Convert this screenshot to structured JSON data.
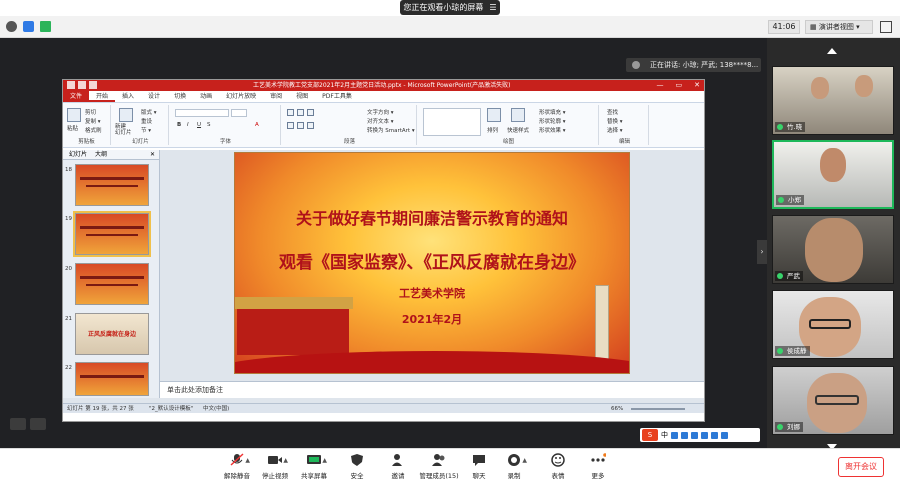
{
  "share_banner": {
    "text": "您正在观看小琼的屏幕"
  },
  "statusbar": {
    "timer": "41:06",
    "view_label": "演讲者视图"
  },
  "speaker": {
    "label": "正在讲话: 小琼; 严武; 138****8..."
  },
  "ppt": {
    "title": "工艺美术学院教工党支部2021年2月主题党日活动.pptx  -  Microsoft PowerPoint(产品激活失败)",
    "menu": [
      "文件",
      "开始",
      "插入",
      "设计",
      "切换",
      "动画",
      "幻灯片放映",
      "审阅",
      "视图",
      "PDF工具集"
    ],
    "ribbon_groups": [
      "剪贴板",
      "幻灯片",
      "字体",
      "段落",
      "绘图",
      "编辑"
    ],
    "ribbon_buttons": {
      "paste": "粘贴",
      "cut": "剪切",
      "copy": "复制 ▾",
      "format_painter": "格式刷",
      "new_slide": "新建\n幻灯片",
      "layout": "版式 ▾",
      "reset": "重设",
      "section": "节 ▾",
      "text_direction": "文字方向 ▾",
      "align_text": "对齐文本 ▾",
      "smartart": "转换为 SmartArt ▾",
      "arrange": "排列",
      "quick_styles": "快速样式",
      "shape_fill": "形状填充 ▾",
      "shape_outline": "形状轮廓 ▾",
      "shape_effects": "形状效果 ▾",
      "find": "查找",
      "replace": "替换 ▾",
      "select": "选择 ▾"
    },
    "panel_tabs": [
      "幻灯片",
      "大纲"
    ],
    "thumb_numbers": [
      "18",
      "19",
      "20",
      "21",
      "22"
    ],
    "thumb21_text": "正风反腐就在身边",
    "slide": {
      "title": "关于做好春节期间廉洁警示教育的通知",
      "subtitle": "观看《国家监察》、《正风反腐就在身边》",
      "org": "工艺美术学院",
      "date": "2021年2月"
    },
    "notes_placeholder": "单击此处添加备注",
    "statusbar": {
      "slide_info": "幻灯片 第 19 张，共 27 张",
      "theme": "\"2_默认设计模板\"",
      "lang": "中文(中国)",
      "zoom": "66%"
    }
  },
  "ime": {
    "label": "中"
  },
  "participants": [
    {
      "name": "竹.晓"
    },
    {
      "name": "小郑"
    },
    {
      "name": "严武"
    },
    {
      "name": "侯成静"
    },
    {
      "name": "刘娜"
    }
  ],
  "toolbar": {
    "items": [
      "解除静音",
      "停止视频",
      "共享屏幕",
      "安全",
      "邀请",
      "管理成员(15)",
      "聊天",
      "录制",
      "表情",
      "更多"
    ],
    "leave": "离开会议"
  },
  "colors": {
    "ppt_accent": "#c7211c",
    "active_speaker": "#1eb85a",
    "leave": "#ee3333"
  }
}
